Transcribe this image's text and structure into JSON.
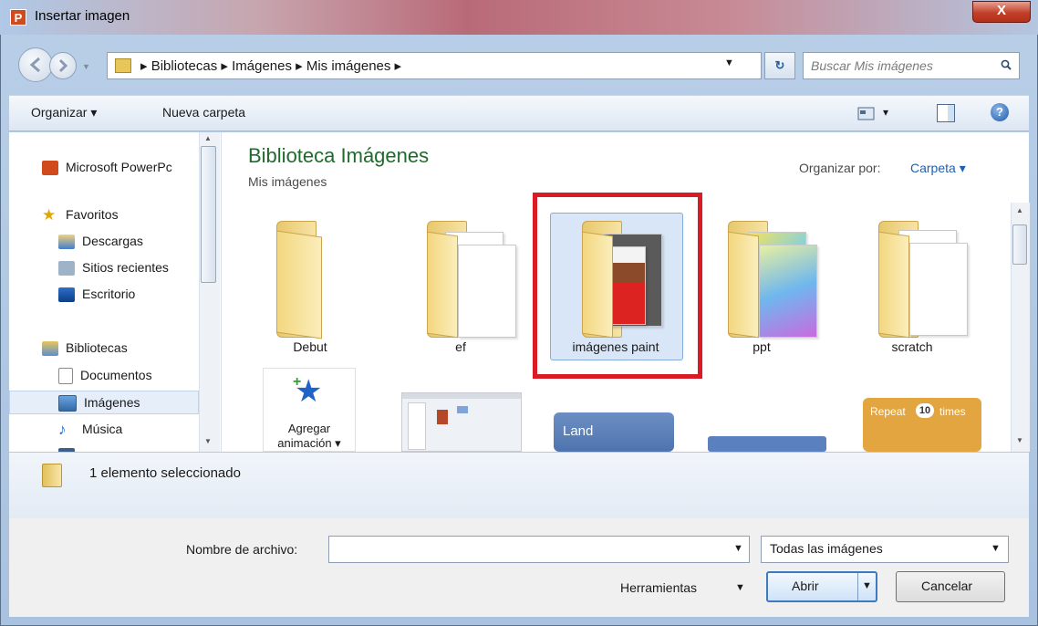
{
  "window": {
    "title": "Insertar imagen",
    "app_icon_letter": "P",
    "close_symbol": "X"
  },
  "address": {
    "path": "▸  Bibliotecas  ▸  Imágenes  ▸  Mis imágenes  ▸",
    "dropdown_symbol": "▼",
    "refresh_symbol": "↻"
  },
  "search": {
    "placeholder": "Buscar Mis imágenes"
  },
  "toolbar": {
    "organize_label": "Organizar ▾",
    "new_folder_label": "Nueva carpeta",
    "view_arrow": "▾",
    "help_symbol": "?"
  },
  "sidebar": {
    "items": [
      {
        "label": "Microsoft PowerPc",
        "icon": "powerpoint-icon"
      },
      {
        "label": "Favoritos",
        "icon": "star-icon"
      },
      {
        "label": "Descargas",
        "icon": "downloads-icon"
      },
      {
        "label": "Sitios recientes",
        "icon": "recent-places-icon"
      },
      {
        "label": "Escritorio",
        "icon": "desktop-icon"
      },
      {
        "label": "Bibliotecas",
        "icon": "libraries-icon"
      },
      {
        "label": "Documentos",
        "icon": "documents-icon"
      },
      {
        "label": "Imágenes",
        "icon": "pictures-icon"
      },
      {
        "label": "Música",
        "icon": "music-icon"
      }
    ],
    "scroll_up": "▲",
    "scroll_down": "▼"
  },
  "content": {
    "library_title": "Biblioteca Imágenes",
    "library_subtitle": "Mis imágenes",
    "arrange_label": "Organizar por:",
    "arrange_value": "Carpeta ▾",
    "folders": [
      {
        "label": "Debut"
      },
      {
        "label": "ef"
      },
      {
        "label": "imágenes paint",
        "selected": true
      },
      {
        "label": "ppt"
      },
      {
        "label": "scratch"
      }
    ],
    "second_row": {
      "add_animation_line1": "Agregar",
      "add_animation_line2": "animación ▾",
      "land_block": "Land",
      "repeat_block": "Repeat",
      "repeat_count": "10",
      "repeat_suffix": "times"
    },
    "scroll_up": "▲",
    "scroll_down": "▼"
  },
  "details": {
    "status": "1 elemento seleccionado"
  },
  "bottom": {
    "filename_label": "Nombre de archivo:",
    "filename_value": "",
    "dropdown_symbol": "▼",
    "filetype_value": "Todas las imágenes",
    "tools_label": "Herramientas",
    "open_label": "Abrir",
    "cancel_label": "Cancelar"
  },
  "colors": {
    "library_title": "#1e6b2d",
    "link_blue": "#1f5fb5",
    "highlight_red": "#d91b25",
    "selection_blue": "#d8e6f8"
  }
}
